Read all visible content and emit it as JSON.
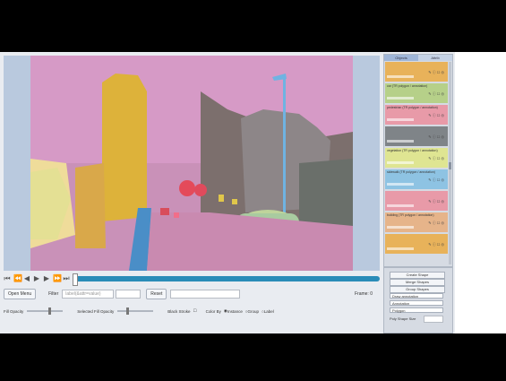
{
  "app": {
    "panel_tabs": [
      "Objects",
      "Attrib"
    ],
    "objects": [
      {
        "color": "#e8b25a",
        "label": "",
        "icons": "✎ ⓘ ☐ ◎"
      },
      {
        "color": "#b6d089",
        "label": "car (TR polygon / annotation)",
        "icons": "✎ ⓘ ☐ ◎"
      },
      {
        "color": "#e89aa8",
        "label": "pedestrian (TR polygon / annotation)",
        "icons": "✎ ⓘ ☐ ◎"
      },
      {
        "color": "#7f8488",
        "label": "",
        "icons": "✎ ⓘ ☐ ◎"
      },
      {
        "color": "#dfe592",
        "label": "vegetation (TR polygon / annotation)",
        "icons": "✎ ⓘ ☐ ◎"
      },
      {
        "color": "#8ec3e3",
        "label": "sidewalk (TR polygon / annotation)",
        "icons": "✎ ⓘ ☐ ◎"
      },
      {
        "color": "#e89aa8",
        "label": "",
        "icons": "✎ ⓘ ☐ ◎"
      },
      {
        "color": "#e6b48a",
        "label": "building (TR polygon / annotation)",
        "icons": "✎ ⓘ ☐ ◎"
      },
      {
        "color": "#e8b25a",
        "label": "",
        "icons": "✎ ⓘ ☐ ◎"
      }
    ],
    "toolbar": {
      "open_menu": "Open Menu",
      "filter_label": "Filter",
      "filter_placeholder": "label(&attr=value)",
      "reset": "Reset",
      "frame_label": "Frame: 0"
    },
    "sliders": {
      "fill_opacity": "Fill Opacity",
      "selected_fill_opacity": "Selected Fill Opacity",
      "black_stroke": "Black Stroke",
      "color_by": "Color By",
      "color_options": [
        "Instance",
        "Group",
        "Label"
      ]
    },
    "controls": {
      "create_shape": "Create Shape",
      "merge_shapes": "Merge Shapes",
      "group_shapes": "Group Shapes",
      "select_annotation": "Draw annotation",
      "select_shape": "Annotation",
      "select_type": "Polygon",
      "poly_shape_size": "Poly Shape Size"
    },
    "timeline_buttons": [
      "⏮",
      "⏪",
      "◀",
      "▶",
      "⏩",
      "⏭",
      "⏵"
    ]
  }
}
